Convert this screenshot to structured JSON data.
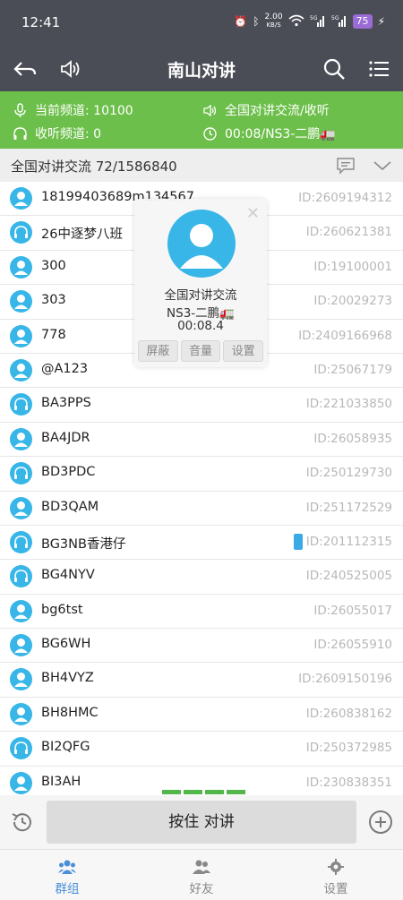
{
  "status_bar": {
    "time": "12:41",
    "net_speed": "2.00",
    "net_unit": "KB/S",
    "battery": "75",
    "icons": [
      "alarm-icon",
      "bluetooth-icon",
      "wifi-icon",
      "signal-5g-icon",
      "signal-5g-icon",
      "charging-icon"
    ]
  },
  "app_bar": {
    "title": "南山对讲",
    "icons": [
      "back-icon",
      "speaker-icon",
      "search-icon",
      "menu-icon"
    ]
  },
  "info_bar": {
    "current_channel": "当前频道: 10100",
    "listen_channel": "收听频道: 0",
    "channel_name": "全国对讲交流/收听",
    "session": "00:08/NS3-二鹏🚛",
    "bg_color": "#6cbf4a"
  },
  "group_header": {
    "label": "全国对讲交流 72/1586840"
  },
  "members": [
    {
      "name": "18199403689m134567",
      "id": "ID:2609194312",
      "icon": "person-icon"
    },
    {
      "name": "26中逐梦八班",
      "id": "ID:260621381",
      "icon": "headset-icon"
    },
    {
      "name": "300",
      "id": "ID:19100001",
      "icon": "person-icon"
    },
    {
      "name": "303",
      "id": "ID:20029273",
      "icon": "person-icon"
    },
    {
      "name": "778",
      "id": "ID:2409166968",
      "icon": "person-icon"
    },
    {
      "name": "@A123",
      "id": "ID:25067179",
      "icon": "person-icon"
    },
    {
      "name": "BA3PPS",
      "id": "ID:221033850",
      "icon": "headset-icon"
    },
    {
      "name": "BA4JDR",
      "id": "ID:26058935",
      "icon": "person-icon"
    },
    {
      "name": "BD3PDC",
      "id": "ID:250129730",
      "icon": "headset-icon"
    },
    {
      "name": "BD3QAM",
      "id": "ID:251172529",
      "icon": "person-icon"
    },
    {
      "name": "BG3NB香港仔",
      "id": "ID:201112315",
      "icon": "headset-icon"
    },
    {
      "name": "BG4NYV",
      "id": "ID:240525005",
      "icon": "headset-icon"
    },
    {
      "name": "bg6tst",
      "id": "ID:26055017",
      "icon": "person-icon"
    },
    {
      "name": "BG6WH",
      "id": "ID:26055910",
      "icon": "person-icon"
    },
    {
      "name": "BH4VYZ",
      "id": "ID:2609150196",
      "icon": "person-icon"
    },
    {
      "name": "BH8HMC",
      "id": "ID:260838162",
      "icon": "person-icon"
    },
    {
      "name": "BI2QFG",
      "id": "ID:250372985",
      "icon": "headset-icon"
    },
    {
      "name": "BI3AH",
      "id": "ID:230838351",
      "icon": "person-icon"
    }
  ],
  "popup": {
    "channel": "全国对讲交流",
    "speaker": "NS3-二鹏🚛",
    "time": "00:08.4",
    "buttons": [
      "屏蔽",
      "音量",
      "设置"
    ]
  },
  "ptt": {
    "label": "按住 对讲"
  },
  "tabs": [
    {
      "label": "群组",
      "icon": "group-icon"
    },
    {
      "label": "好友",
      "icon": "friends-icon"
    },
    {
      "label": "设置",
      "icon": "gear-icon"
    }
  ],
  "colors": {
    "top_bar": "#4b4d56",
    "accent_blue": "#38b6e8",
    "active_tab": "#4a90d9"
  }
}
